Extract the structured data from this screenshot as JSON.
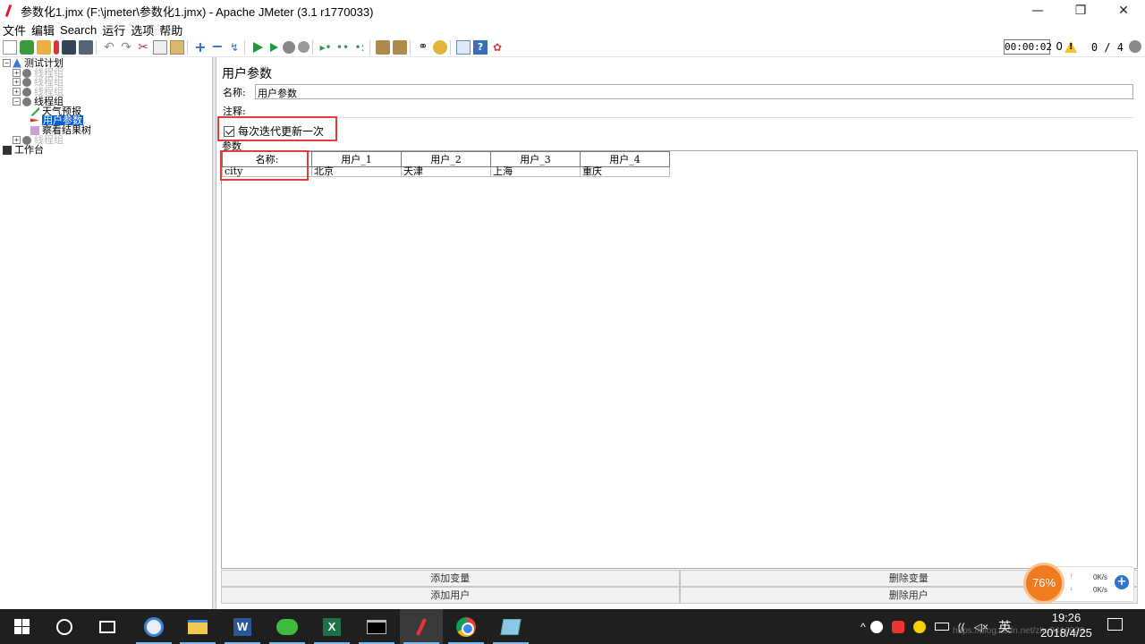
{
  "window": {
    "title": "参数化1.jmx (F:\\jmeter\\参数化1.jmx) - Apache JMeter (3.1 r1770033)",
    "minimize": "—",
    "maximize": "❐",
    "close": "✕"
  },
  "menu": [
    "文件",
    "编辑",
    "Search",
    "运行",
    "选项",
    "帮助"
  ],
  "status": {
    "elapsed": "00:00:02",
    "errors": "0",
    "threads": "0 / 4"
  },
  "tree": [
    {
      "label": "测试计划",
      "icon": "plan-icon",
      "expander": "⊟",
      "level": 0,
      "style": "normal"
    },
    {
      "label": "线程组",
      "icon": "thread-group-icon",
      "expander": "⊞",
      "level": 1,
      "style": "faded"
    },
    {
      "label": "线程组",
      "icon": "thread-group-icon",
      "expander": "⊞",
      "level": 1,
      "style": "faded"
    },
    {
      "label": "线程组",
      "icon": "thread-group-icon",
      "expander": "⊞",
      "level": 1,
      "style": "faded"
    },
    {
      "label": "线程组",
      "icon": "thread-group-icon",
      "expander": "⊟",
      "level": 1,
      "style": "normal"
    },
    {
      "label": "天气预报",
      "icon": "sampler-icon",
      "expander": "",
      "level": 2,
      "style": "normal"
    },
    {
      "label": "用户参数",
      "icon": "config-icon",
      "expander": "",
      "level": 2,
      "style": "selected"
    },
    {
      "label": "察看结果树",
      "icon": "listener-icon",
      "expander": "",
      "level": 2,
      "style": "normal"
    },
    {
      "label": "线程组",
      "icon": "thread-group-icon",
      "expander": "⊞",
      "level": 1,
      "style": "faded"
    },
    {
      "label": "工作台",
      "icon": "workbench-icon",
      "expander": "",
      "level": 0,
      "style": "normal"
    }
  ],
  "panel": {
    "title": "用户参数",
    "name_label": "名称:",
    "name_value": "用户参数",
    "comment_label": "注释:",
    "comment_value": "",
    "checkbox_label": "每次迭代更新一次",
    "checkbox_checked": true,
    "params_label": "参数",
    "table": {
      "headers": [
        "名称:",
        "用户_1",
        "用户_2",
        "用户_3",
        "用户_4"
      ],
      "rows": [
        [
          "city",
          "北京",
          "天津",
          "上海",
          "重庆"
        ]
      ]
    },
    "buttons": {
      "add_var": "添加变量",
      "del_var": "删除变量",
      "add_user": "添加用户",
      "del_user": "删除用户"
    }
  },
  "speed_widget": {
    "percent": "76%",
    "up_arrow": "↑",
    "down_arrow": "↓",
    "up_rate": "0K/s",
    "down_rate": "0K/s",
    "plus": "+"
  },
  "taskbar": {
    "apps": [
      "start",
      "cortana",
      "task-view",
      "qq",
      "file-explorer",
      "word",
      "wechat",
      "excel",
      "cmd",
      "jmeter",
      "chrome",
      "notes"
    ],
    "tray": {
      "caret": "^",
      "ime": "英",
      "wifi": "((",
      "sound": "◁×"
    },
    "time": "19:26",
    "date": "2018/4/25",
    "watermark": "https://blog.csdn.net/zhu9416923"
  }
}
